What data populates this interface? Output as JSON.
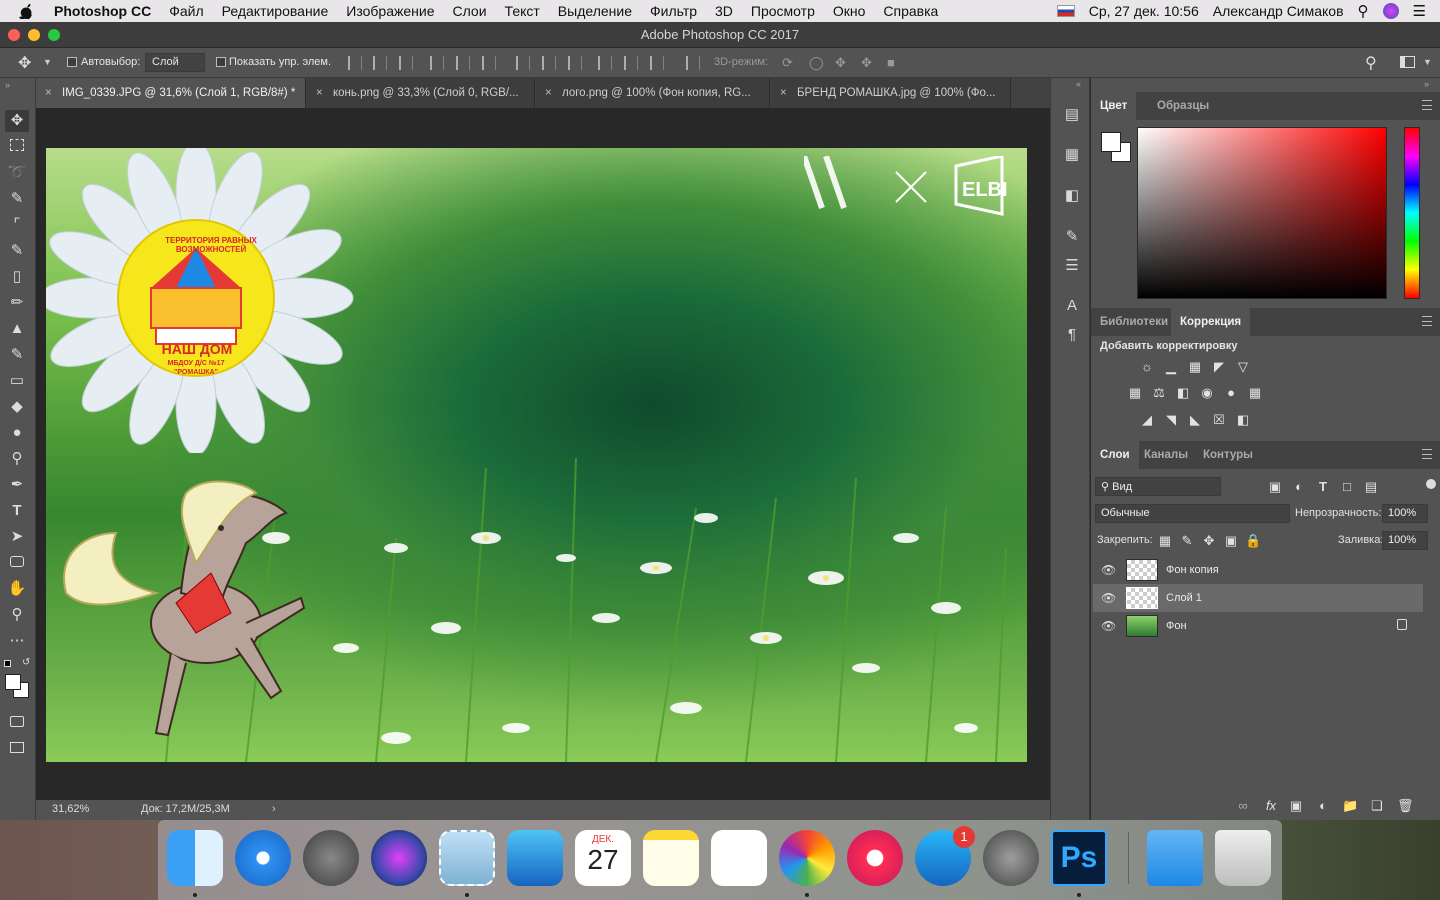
{
  "menubar": {
    "app_name": "Photoshop CC",
    "items": [
      "Файл",
      "Редактирование",
      "Изображение",
      "Слои",
      "Текст",
      "Выделение",
      "Фильтр",
      "3D",
      "Просмотр",
      "Окно",
      "Справка"
    ],
    "datetime": "Ср, 27 дек. 10:56",
    "user": "Александр Симаков"
  },
  "window": {
    "title": "Adobe Photoshop CC 2017"
  },
  "options": {
    "autoselect_label": "Автовыбор:",
    "autoselect_value": "Слой",
    "show_transform_label": "Показать упр. элем.",
    "mode3d_label": "3D-режим:"
  },
  "doc_tabs": [
    "IMG_0339.JPG @ 31,6% (Слой 1, RGB/8#) *",
    "конь.png @ 33,3% (Слой 0, RGB/...",
    "лого.png @ 100% (Фон копия, RG...",
    "БРЕНД РОМАШКА.jpg @ 100% (Фо..."
  ],
  "canvas": {
    "logo_arc_text": "ТЕРРИТОРИЯ РАВНЫХ ВОЗМОЖНОСТЕЙ",
    "logo_main": "НАШ ДОМ",
    "logo_sub1": "МБДОУ Д/С №17",
    "logo_sub2": "\"РОМАШКА\""
  },
  "status": {
    "zoom": "31,62%",
    "doc": "Док: 17,2M/25,3M"
  },
  "color_panel": {
    "tabs": [
      "Цвет",
      "Образцы"
    ]
  },
  "adjust_panel": {
    "tabs": [
      "Библиотеки",
      "Коррекция"
    ],
    "add_label": "Добавить корректировку"
  },
  "layers_panel": {
    "tabs": [
      "Слои",
      "Каналы",
      "Контуры"
    ],
    "filter_label": "Вид",
    "blend_mode": "Обычные",
    "opacity_label": "Непрозрачность:",
    "opacity_value": "100%",
    "lock_label": "Закрепить:",
    "fill_label": "Заливка:",
    "fill_value": "100%",
    "layers": [
      {
        "name": "Фон копия"
      },
      {
        "name": "Слой 1"
      },
      {
        "name": "Фон"
      }
    ]
  },
  "dock": {
    "calendar_month": "ДЕК.",
    "calendar_day": "27",
    "appstore_badge": "1",
    "ps_label": "Ps"
  }
}
